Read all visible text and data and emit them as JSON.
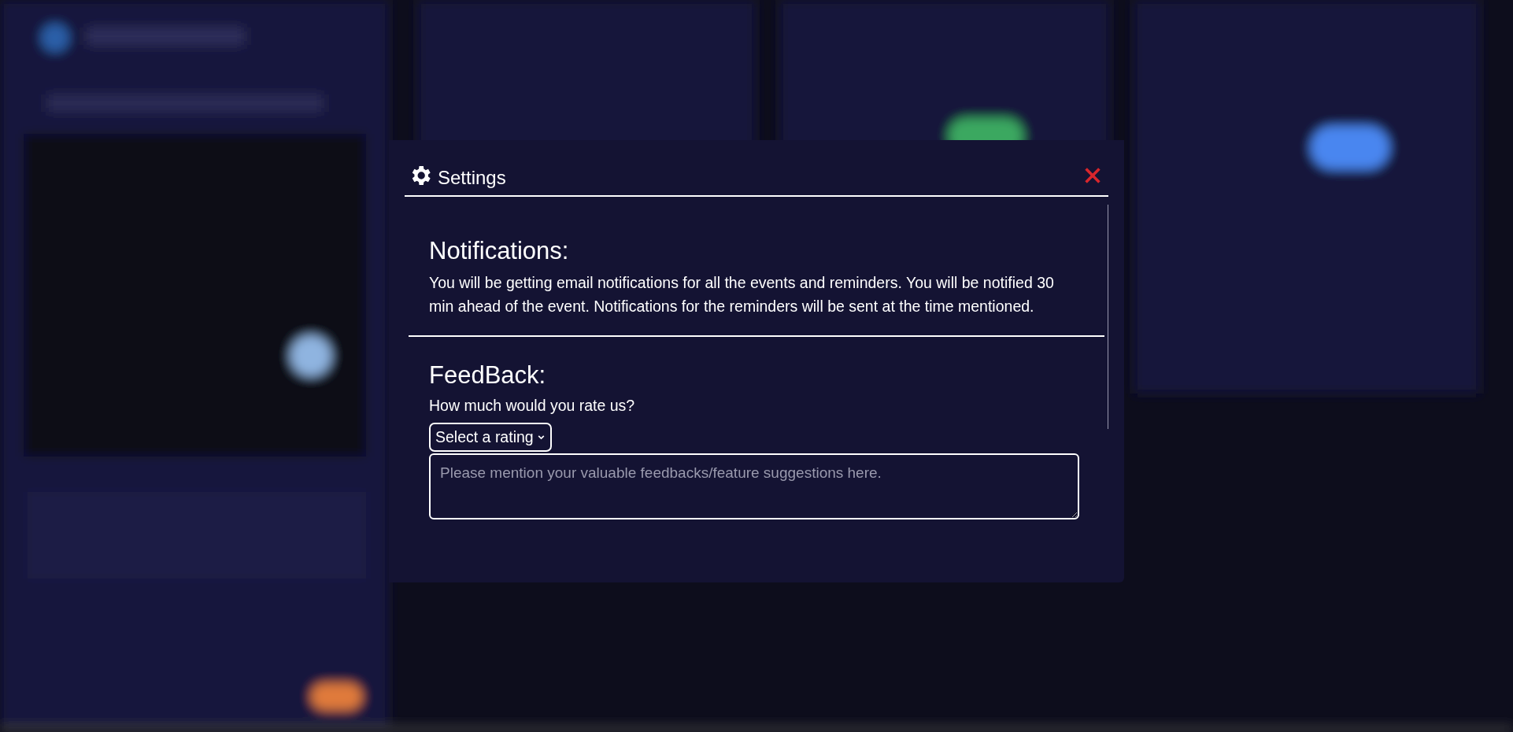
{
  "dialog": {
    "title": "Settings"
  },
  "notifications": {
    "heading": "Notifications:",
    "text": "You will be getting email notifications for all the events and reminders. You will be notified 30 min ahead of the event. Notifications for the reminders will be sent at the time mentioned."
  },
  "feedback": {
    "heading": "FeedBack:",
    "question": "How much would you rate us?",
    "rating": {
      "value": "Select a rating"
    },
    "comments": {
      "placeholder": "Please mention your valuable feedbacks/feature suggestions here."
    }
  }
}
